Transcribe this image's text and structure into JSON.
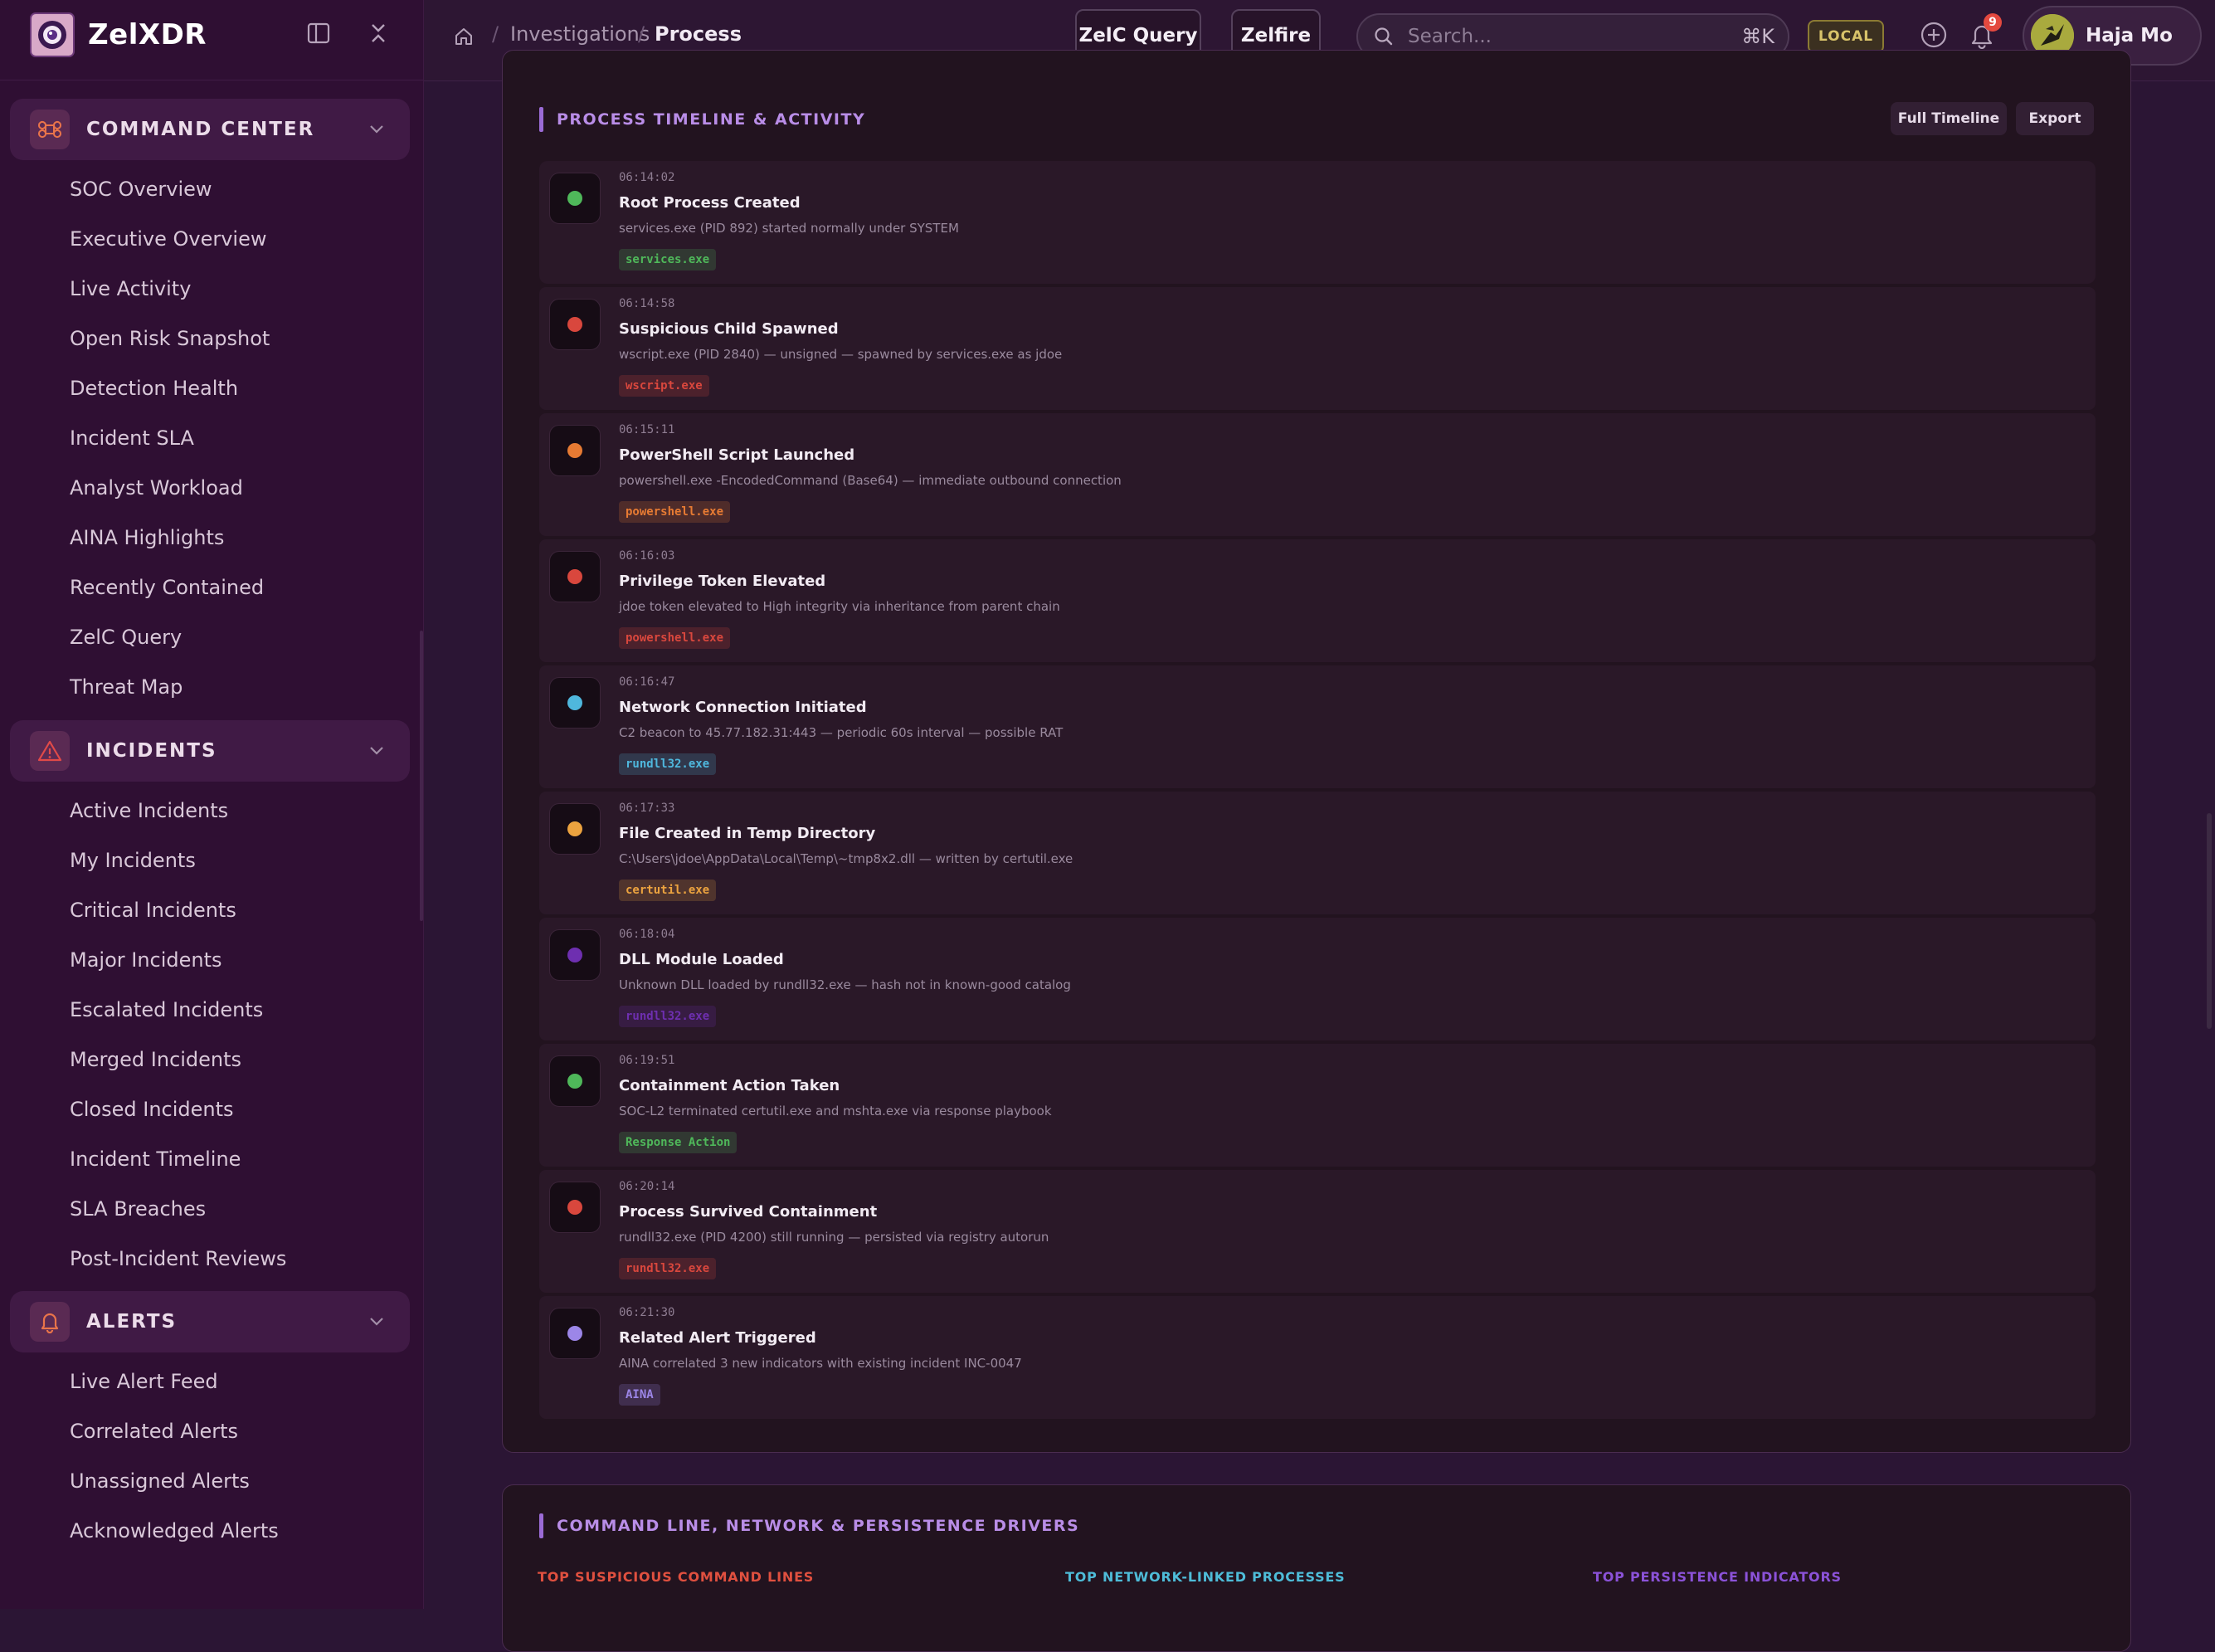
{
  "brand": {
    "name": "ZelXDR"
  },
  "sidebar": {
    "sections": [
      {
        "label": "COMMAND CENTER",
        "icon": "command-icon",
        "items": [
          "SOC Overview",
          "Executive Overview",
          "Live Activity",
          "Open Risk Snapshot",
          "Detection Health",
          "Incident SLA",
          "Analyst Workload",
          "AINA Highlights",
          "Recently Contained",
          "ZelC Query",
          "Threat Map"
        ]
      },
      {
        "label": "INCIDENTS",
        "icon": "warning-icon",
        "items": [
          "Active Incidents",
          "My Incidents",
          "Critical Incidents",
          "Major Incidents",
          "Escalated Incidents",
          "Merged Incidents",
          "Closed Incidents",
          "Incident Timeline",
          "SLA Breaches",
          "Post-Incident Reviews"
        ]
      },
      {
        "label": "ALERTS",
        "icon": "bell-icon",
        "items": [
          "Live Alert Feed",
          "Correlated Alerts",
          "Unassigned Alerts",
          "Acknowledged Alerts"
        ]
      }
    ]
  },
  "header": {
    "breadcrumbs": [
      "Investigations",
      "Process"
    ],
    "zelc_query_label": "ZelC Query",
    "zelfire_label": "Zelfire",
    "search_placeholder": "Search...",
    "search_shortcut": "⌘K",
    "env_badge": "LOCAL",
    "notification_count": "9",
    "user_name": "Haja Mo"
  },
  "timeline_panel": {
    "title": "PROCESS TIMELINE & ACTIVITY",
    "full_timeline_label": "Full Timeline",
    "export_label": "Export",
    "events": [
      {
        "time": "06:14:02",
        "title": "Root Process Created",
        "desc": "services.exe (PID 892) started normally under SYSTEM",
        "tag": "services.exe",
        "color": "#4fb85a"
      },
      {
        "time": "06:14:58",
        "title": "Suspicious Child Spawned",
        "desc": "wscript.exe (PID 2840) — unsigned — spawned by services.exe as jdoe",
        "tag": "wscript.exe",
        "color": "#d9473d"
      },
      {
        "time": "06:15:11",
        "title": "PowerShell Script Launched",
        "desc": "powershell.exe -EncodedCommand (Base64) — immediate outbound connection",
        "tag": "powershell.exe",
        "color": "#e77b33"
      },
      {
        "time": "06:16:03",
        "title": "Privilege Token Elevated",
        "desc": "jdoe token elevated to High integrity via inheritance from parent chain",
        "tag": "powershell.exe",
        "color": "#d9473d"
      },
      {
        "time": "06:16:47",
        "title": "Network Connection Initiated",
        "desc": "C2 beacon to 45.77.182.31:443 — periodic 60s interval — possible RAT",
        "tag": "rundll32.exe",
        "color": "#4fb7dd"
      },
      {
        "time": "06:17:33",
        "title": "File Created in Temp Directory",
        "desc": "C:\\Users\\jdoe\\AppData\\Local\\Temp\\~tmp8x2.dll — written by certutil.exe",
        "tag": "certutil.exe",
        "color": "#eca33f"
      },
      {
        "time": "06:18:04",
        "title": "DLL Module Loaded",
        "desc": "Unknown DLL loaded by rundll32.exe — hash not in known-good catalog",
        "tag": "rundll32.exe",
        "color": "#6e2fb0"
      },
      {
        "time": "06:19:51",
        "title": "Containment Action Taken",
        "desc": "SOC-L2 terminated certutil.exe and mshta.exe via response playbook",
        "tag": "Response Action",
        "color": "#4fb85a"
      },
      {
        "time": "06:20:14",
        "title": "Process Survived Containment",
        "desc": "rundll32.exe (PID 4200) still running — persisted via registry autorun",
        "tag": "rundll32.exe",
        "color": "#d9473d"
      },
      {
        "time": "06:21:30",
        "title": "Related Alert Triggered",
        "desc": "AINA correlated 3 new indicators with existing incident INC-0047",
        "tag": "AINA",
        "color": "#9c86e8"
      }
    ]
  },
  "drivers_panel": {
    "title": "COMMAND LINE, NETWORK & PERSISTENCE DRIVERS",
    "col1": "TOP SUSPICIOUS COMMAND LINES",
    "col2": "TOP NETWORK-LINKED PROCESSES",
    "col3": "TOP PERSISTENCE INDICATORS"
  },
  "colors": {
    "accent": "#b98de7",
    "background": "#2b1534",
    "sidebar": "#2f0f33"
  }
}
